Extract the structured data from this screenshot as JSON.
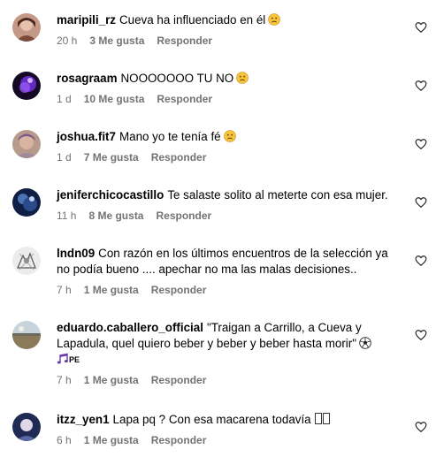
{
  "comments": [
    {
      "username": "maripili_rz",
      "text": "Cueva ha influenciado en él",
      "emoji": "sad-face-emoji",
      "time": "20 h",
      "likes": "3 Me gusta",
      "reply": "Responder",
      "avatar_color": "#b07a6a"
    },
    {
      "username": "rosagraam",
      "text": "NOOOOOOO TU NO",
      "emoji": "sad-face-emoji",
      "time": "1 d",
      "likes": "10 Me gusta",
      "reply": "Responder",
      "avatar_color": "#2a0f4a"
    },
    {
      "username": "joshua.fit7",
      "text": "Mano yo te tenía fé",
      "emoji": "sad-face-emoji",
      "time": "1 d",
      "likes": "7 Me gusta",
      "reply": "Responder",
      "avatar_color": "#9a7a6a"
    },
    {
      "username": "jeniferchicocastillo",
      "text": "Te salaste solito al meterte con esa mujer.",
      "time": "11 h",
      "likes": "8 Me gusta",
      "reply": "Responder",
      "avatar_color": "#1f3a6a"
    },
    {
      "username": "lndn09",
      "text": "Con razón en los últimos encuentros de la selección ya no podía bueno .... apechar no ma las malas decisiones..",
      "time": "7 h",
      "likes": "1 Me gusta",
      "reply": "Responder",
      "avatar_color": "#d9d9d9"
    },
    {
      "username": "eduardo.caballero_official",
      "text": "\"Traigan a Carrillo, a Cueva y Lapadula, quel quiero beber y beber y beber hasta morir\"",
      "emoji": "soccer-ball-emoji",
      "extra_emoji": "musical-notes-emoji",
      "extra_text": "PE",
      "time": "7 h",
      "likes": "1 Me gusta",
      "reply": "Responder",
      "avatar_color": "#8a8f8a"
    },
    {
      "username": "itzz_yen1",
      "text": "Lapa pq ? Con esa macarena todavía",
      "time": "6 h",
      "likes": "1 Me gusta",
      "reply": "Responder",
      "avatar_color": "#3a4a7a"
    }
  ],
  "colors": {
    "meta_text": "#737373",
    "text": "#000000"
  }
}
